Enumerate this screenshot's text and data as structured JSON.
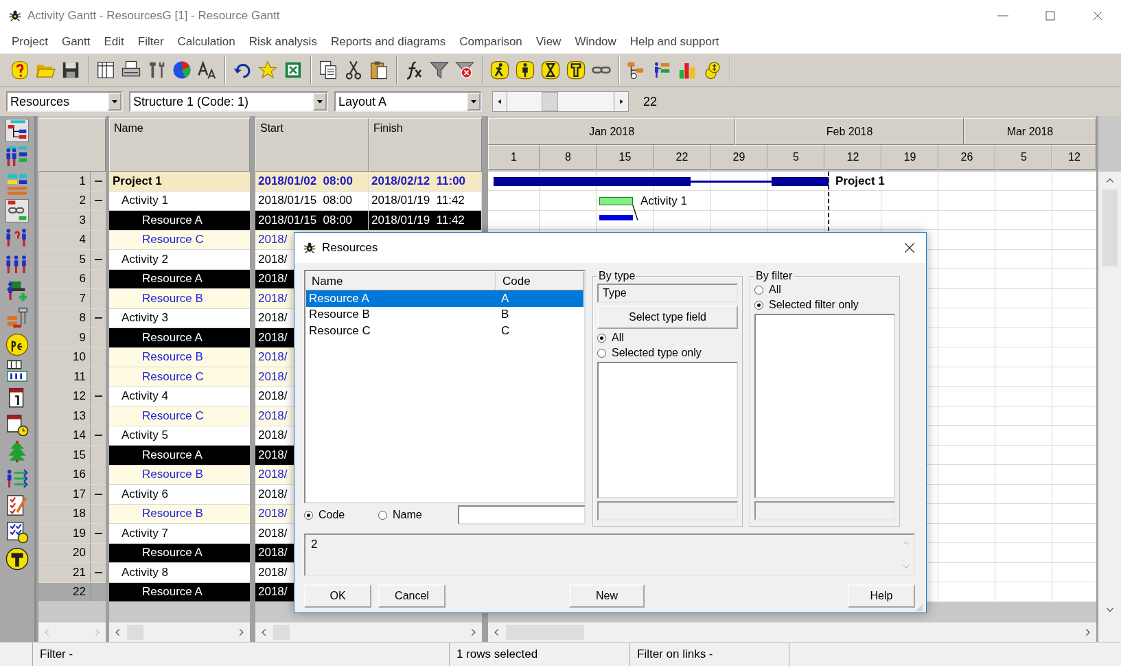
{
  "window": {
    "title": "Activity Gantt - ResourcesG [1] - Resource Gantt"
  },
  "menu": [
    "Project",
    "Gantt",
    "Edit",
    "Filter",
    "Calculation",
    "Risk analysis",
    "Reports and diagrams",
    "Comparison",
    "View",
    "Window",
    "Help and support"
  ],
  "selectors": [
    {
      "value": "Resources"
    },
    {
      "value": "Structure 1 (Code: 1)"
    },
    {
      "value": "Layout A"
    }
  ],
  "zoom_slider": {
    "level": 0.38
  },
  "row_count": "22",
  "columns": {
    "name": "Name",
    "start": "Start",
    "finish": "Finish"
  },
  "rows": [
    {
      "number": "1",
      "kind": "project",
      "expanded": true,
      "highlighted": false,
      "selected": false,
      "name": "Project 1",
      "start": "2018/01/02  08:00",
      "finish": "2018/02/12  11:00",
      "gantt_bar": {
        "kind": "summary",
        "label": "Project 1"
      }
    },
    {
      "number": "2",
      "kind": "activity",
      "expanded": true,
      "highlighted": false,
      "selected": false,
      "name": "Activity 1",
      "start": "2018/01/15  08:00",
      "finish": "2018/01/19  11:42",
      "gantt_bar": {
        "kind": "task",
        "label": "Activity 1"
      }
    },
    {
      "number": "3",
      "kind": "resource",
      "expanded": false,
      "highlighted": true,
      "selected": false,
      "name": "Resource A",
      "start": "2018/01/15  08:00",
      "finish": "2018/01/19  11:42",
      "gantt_bar": {
        "kind": "assignment"
      }
    },
    {
      "number": "4",
      "kind": "resource",
      "expanded": false,
      "highlighted": false,
      "selected": false,
      "name": "Resource C",
      "start": "2018/"
    },
    {
      "number": "5",
      "kind": "activity",
      "expanded": true,
      "highlighted": false,
      "selected": false,
      "name": "Activity 2",
      "start": "2018/"
    },
    {
      "number": "6",
      "kind": "resource",
      "expanded": false,
      "highlighted": true,
      "selected": false,
      "name": "Resource A",
      "start": "2018/"
    },
    {
      "number": "7",
      "kind": "resource",
      "expanded": false,
      "highlighted": false,
      "selected": false,
      "name": "Resource B",
      "start": "2018/"
    },
    {
      "number": "8",
      "kind": "activity",
      "expanded": true,
      "highlighted": false,
      "selected": false,
      "name": "Activity 3",
      "start": "2018/"
    },
    {
      "number": "9",
      "kind": "resource",
      "expanded": false,
      "highlighted": true,
      "selected": false,
      "name": "Resource A",
      "start": "2018/"
    },
    {
      "number": "10",
      "kind": "resource",
      "expanded": false,
      "highlighted": false,
      "selected": false,
      "name": "Resource B",
      "start": "2018/"
    },
    {
      "number": "11",
      "kind": "resource",
      "expanded": false,
      "highlighted": false,
      "selected": false,
      "name": "Resource C",
      "start": "2018/"
    },
    {
      "number": "12",
      "kind": "activity",
      "expanded": true,
      "highlighted": false,
      "selected": false,
      "name": "Activity 4",
      "start": "2018/"
    },
    {
      "number": "13",
      "kind": "resource",
      "expanded": false,
      "highlighted": false,
      "selected": false,
      "name": "Resource C",
      "start": "2018/"
    },
    {
      "number": "14",
      "kind": "activity",
      "expanded": true,
      "highlighted": false,
      "selected": false,
      "name": "Activity 5",
      "start": "2018/"
    },
    {
      "number": "15",
      "kind": "resource",
      "expanded": false,
      "highlighted": true,
      "selected": false,
      "name": "Resource A",
      "start": "2018/"
    },
    {
      "number": "16",
      "kind": "resource",
      "expanded": false,
      "highlighted": false,
      "selected": false,
      "name": "Resource B",
      "start": "2018/"
    },
    {
      "number": "17",
      "kind": "activity",
      "expanded": true,
      "highlighted": false,
      "selected": false,
      "name": "Activity 6",
      "start": "2018/"
    },
    {
      "number": "18",
      "kind": "resource",
      "expanded": false,
      "highlighted": false,
      "selected": false,
      "name": "Resource B",
      "start": "2018/"
    },
    {
      "number": "19",
      "kind": "activity",
      "expanded": true,
      "highlighted": false,
      "selected": false,
      "name": "Activity 7",
      "start": "2018/"
    },
    {
      "number": "20",
      "kind": "resource",
      "expanded": false,
      "highlighted": true,
      "selected": false,
      "name": "Resource A",
      "start": "2018/"
    },
    {
      "number": "21",
      "kind": "activity",
      "expanded": true,
      "highlighted": false,
      "selected": false,
      "name": "Activity 8",
      "start": "2018/"
    },
    {
      "number": "22",
      "kind": "resource",
      "expanded": false,
      "highlighted": true,
      "selected": true,
      "name": "Resource A",
      "start": "2018/"
    }
  ],
  "timeline": {
    "months": [
      "Jan 2018",
      "Feb 2018",
      "Mar 2018"
    ],
    "weeks": [
      "1",
      "8",
      "15",
      "22",
      "29",
      "5",
      "12",
      "19",
      "26",
      "5",
      "12"
    ]
  },
  "dialog": {
    "title": "Resources",
    "list": {
      "columns": [
        "Name",
        "Code"
      ],
      "items": [
        {
          "name": "Resource A",
          "code": "A",
          "selected": true
        },
        {
          "name": "Resource B",
          "code": "B",
          "selected": false
        },
        {
          "name": "Resource C",
          "code": "C",
          "selected": false
        }
      ]
    },
    "search_by": [
      {
        "label": "Code",
        "selected": true
      },
      {
        "label": "Name",
        "selected": false
      }
    ],
    "by_type": {
      "title": "By type",
      "field": "Type",
      "button": "Select type field",
      "options": [
        {
          "label": "All",
          "selected": true
        },
        {
          "label": "Selected type only",
          "selected": false
        }
      ]
    },
    "by_filter": {
      "title": "By filter",
      "options": [
        {
          "label": "All",
          "selected": false
        },
        {
          "label": "Selected filter only",
          "selected": true
        }
      ]
    },
    "memo": "2",
    "buttons": [
      "OK",
      "Cancel",
      "New",
      "Help"
    ]
  },
  "status_bar": [
    "Filter -",
    "1 rows selected",
    "Filter on links -"
  ]
}
